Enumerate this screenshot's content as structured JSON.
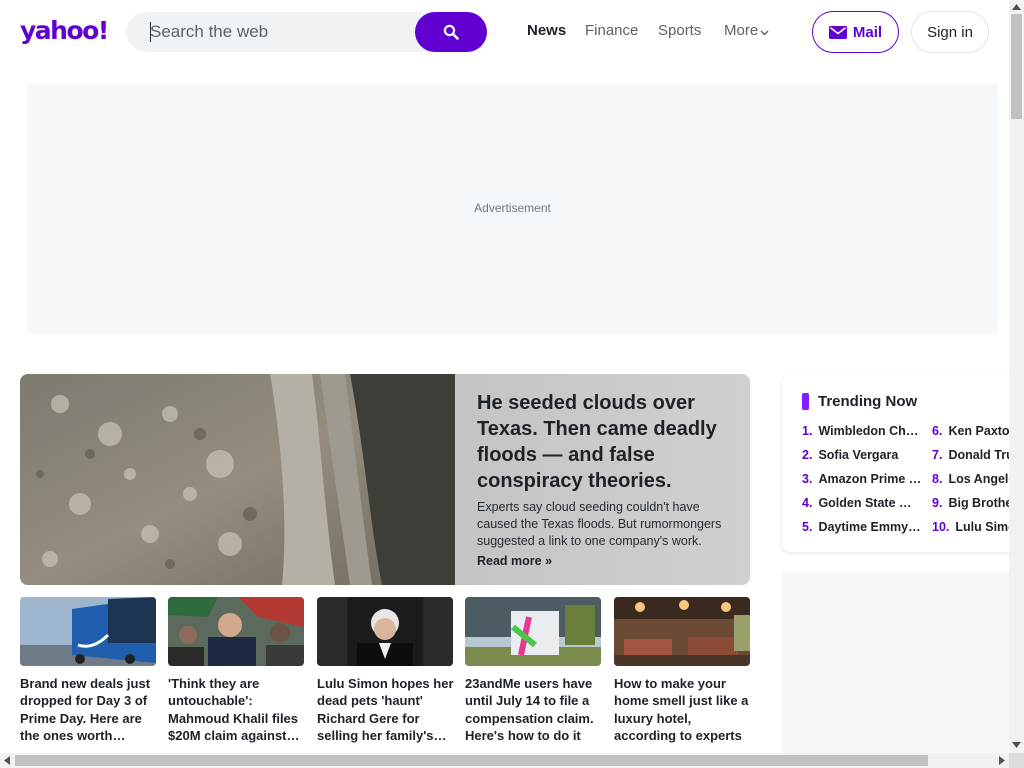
{
  "header": {
    "logo": "yahoo!",
    "search": {
      "placeholder": "Search the web"
    },
    "nav": [
      {
        "label": "News",
        "active": true
      },
      {
        "label": "Finance",
        "active": false
      },
      {
        "label": "Sports",
        "active": false
      },
      {
        "label": "More",
        "active": false
      }
    ],
    "mail_label": "Mail",
    "signin_label": "Sign in"
  },
  "ad": {
    "label": "Advertisement"
  },
  "hero": {
    "title": "He seeded clouds over Texas. Then came deadly floods — and false conspiracy theories.",
    "summary": "Experts say cloud seeding couldn't have caused the Texas floods. But rumormongers suggested a link to one company's work.",
    "link": "Read more »"
  },
  "stories": [
    {
      "title": "Brand new deals just dropped for Day 3 of Prime Day. Here are the ones worth shopping"
    },
    {
      "title": "'Think they are untouchable': Mahmoud Khalil files $20M claim against Trump administration"
    },
    {
      "title": "Lulu Simon hopes her dead pets 'haunt' Richard Gere for selling her family's home"
    },
    {
      "title": "23andMe users have until July 14 to file a compensation claim. Here's how to do it"
    },
    {
      "title": "How to make your home smell just like a luxury hotel, according to experts"
    }
  ],
  "trending": {
    "title": "Trending Now",
    "items": [
      {
        "num": "1.",
        "label": "Wimbledon Championships"
      },
      {
        "num": "2.",
        "label": "Sofia Vergara"
      },
      {
        "num": "3.",
        "label": "Amazon Prime Day"
      },
      {
        "num": "4.",
        "label": "Golden State Warriors"
      },
      {
        "num": "5.",
        "label": "Daytime Emmy Awards"
      },
      {
        "num": "6.",
        "label": "Ken Paxton"
      },
      {
        "num": "7.",
        "label": "Donald Trump"
      },
      {
        "num": "8.",
        "label": "Los Angeles"
      },
      {
        "num": "9.",
        "label": "Big Brother"
      },
      {
        "num": "10.",
        "label": "Lulu Simon"
      }
    ]
  },
  "colors": {
    "brand": "#6001d2",
    "accent": "#7e1fff"
  }
}
